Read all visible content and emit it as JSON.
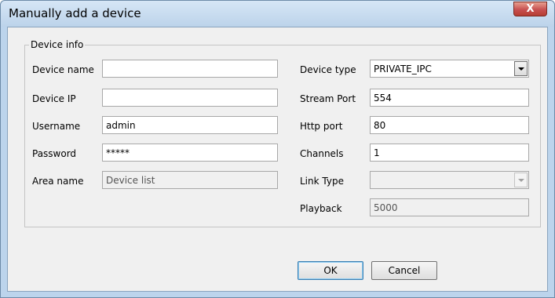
{
  "window": {
    "title": "Manually add a device",
    "close_label": "X"
  },
  "groupbox": {
    "title": "Device info"
  },
  "left_fields": {
    "device_name": {
      "label": "Device name",
      "value": ""
    },
    "device_ip": {
      "label": "Device IP",
      "value": ""
    },
    "username": {
      "label": "Username",
      "value": "admin"
    },
    "password": {
      "label": "Password",
      "value": "*****"
    },
    "area_name": {
      "label": "Area name",
      "value": "Device list"
    }
  },
  "right_fields": {
    "device_type": {
      "label": "Device type",
      "value": "PRIVATE_IPC"
    },
    "stream_port": {
      "label": "Stream Port",
      "value": "554"
    },
    "http_port": {
      "label": "Http port",
      "value": "80"
    },
    "channels": {
      "label": "Channels",
      "value": "1"
    },
    "link_type": {
      "label": "Link Type",
      "value": ""
    },
    "playback": {
      "label": "Playback",
      "value": "5000"
    }
  },
  "buttons": {
    "ok": "OK",
    "cancel": "Cancel"
  }
}
